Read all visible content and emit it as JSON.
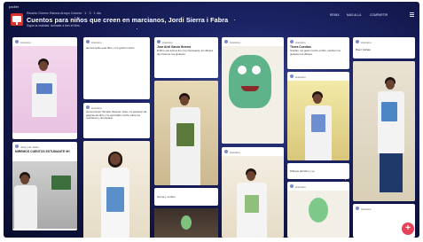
{
  "header": {
    "logo": "padlet",
    "author": "Ricardo Gómez Ramos Arroyo Colores · 1 · 3 · 1 día",
    "title": "Cuentos para niños que creen en marcianos, Jordi Sierra i Fabra",
    "description": "Sigue la realidad. Animate a leer el libro",
    "nav": [
      "REMIX",
      "MAS ALLA",
      "COMPARTIR"
    ],
    "menu_icon": "hamburger-icon"
  },
  "cards": {
    "c1": {
      "user": "Anonimo",
      "caption": ""
    },
    "c2": {
      "user": "Anonimo",
      "body": "Hemos leído este libro, nos gustó mucho",
      "caption": ""
    },
    "c3": {
      "user": "Jose Luis Velez",
      "title": "MIREMOS CUENTOS ESTUDIANTE 9H"
    },
    "c4": {
      "user": "Anonimo",
      "body": "Gema Gómez Tamaño Vazquez. Hola, me gustaron las páginas del libro y he aprendido mucho sobre los marcianos y del espacio."
    },
    "c5": {
      "user": "Anonimo",
      "title": "Jose Ariel García Herrera",
      "body": "El libro que leímos fue muy interesante, los dibujos que hicimos nos gustaron"
    },
    "c6": {
      "user": "Anonimo",
      "caption": "Gema y su libro"
    },
    "c7": {
      "user": "Anonimo",
      "caption": ""
    },
    "c8": {
      "user": "Anonimo",
      "caption": ""
    },
    "c9": {
      "user": "Anonimo",
      "title": "Tierra Cuentos",
      "body": "Gracias, me gustó mucho el libro, también me gustaron los dibujos."
    },
    "c10": {
      "user": "Anonimo",
      "caption": "Dibujos del libro y yo"
    },
    "c11": {
      "user": "Anonimo",
      "caption": ""
    },
    "c12": {
      "user": "Anonimo",
      "caption": "Buen trabajo"
    },
    "c13": {
      "user": "Anonimo",
      "caption": ""
    },
    "c14": {
      "user": "Anonimo",
      "caption": ""
    }
  },
  "fab": {
    "label": "+"
  }
}
